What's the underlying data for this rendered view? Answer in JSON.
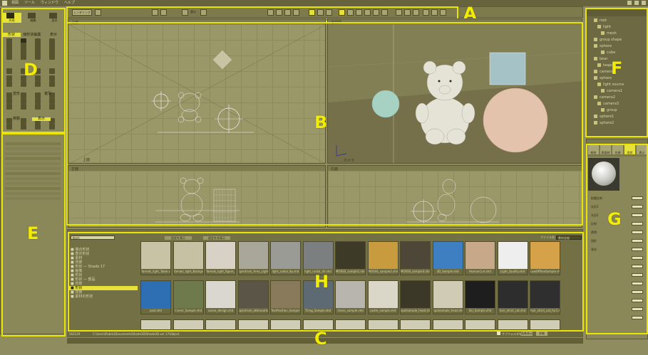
{
  "menu": [
    "",
    "視図",
    "ツール",
    "ウィンドウ",
    "ヘルプ",
    "",
    "",
    "",
    "",
    ""
  ],
  "region_labels": {
    "A": "A",
    "B": "B",
    "C": "C",
    "D": "D",
    "E": "E",
    "F": "F",
    "G": "G",
    "H": "H"
  },
  "toolbar": {
    "render_button_label": "レンダリング",
    "shading_label": "表示"
  },
  "left_tools": {
    "top_tabs": [
      "作成",
      "編集",
      "変形"
    ],
    "section_tabs": [
      "形状",
      "線形状編集",
      "表示"
    ],
    "mid_tabs": [
      "変形",
      "複写",
      "移動"
    ],
    "bottom_tabs": [
      "移動",
      "複写"
    ],
    "bottom_sel": "表示"
  },
  "viewports": [
    {
      "name": "top",
      "label": "上面"
    },
    {
      "name": "perspective",
      "label": "透視図",
      "info": "カメラ"
    },
    {
      "name": "front",
      "label": "正面"
    },
    {
      "name": "right",
      "label": "右面"
    }
  ],
  "browser": {
    "path_value": "Koch",
    "items": [
      "Shade3D",
      "Shade3D",
      "Shade3D",
      "Shade3D"
    ],
    "nav": [
      {
        "label": "■ 複合形状",
        "sel": false
      },
      {
        "label": "■ 表示形状",
        "sel": false
      },
      {
        "label": "■ 素材",
        "sel": false
      },
      {
        "label": "■ 背景",
        "sel": false
      },
      {
        "label": "■ 形状 — Shade 17",
        "sel": false
      },
      {
        "label": "■ 画像",
        "sel": false
      },
      {
        "label": "■ 形状",
        "sel": false
      },
      {
        "label": "■ 形状 — 部品",
        "sel": false
      },
      {
        "label": "■ 背景",
        "sel": false
      },
      {
        "label": "■ 形状",
        "sel": true
      },
      {
        "label": "■ 背景",
        "sel": false
      },
      {
        "label": "■ 素材の形状",
        "sel": false
      }
    ],
    "row1": [
      {
        "caption": "Yamaki_light_Table.shd",
        "bg": "#c9c3a6"
      },
      {
        "caption": "Yamaki_light_Background",
        "bg": "#c7c1a3"
      },
      {
        "caption": "Yamaki_light_figure_fina",
        "bg": "#d8d1c6"
      },
      {
        "caption": "spectrum_Area_Light.shd",
        "bg": "#a9a79a"
      },
      {
        "caption": "light_radial_Sp.shd",
        "bg": "#9a9b95"
      },
      {
        "caption": "light_radial_dir.shd",
        "bg": "#7c7f80"
      },
      {
        "caption": "MOSSS_sample1.shd",
        "bg": "#3d3a28"
      },
      {
        "caption": "MOSSS_sample2.shd",
        "bg": "#c89b3e"
      },
      {
        "caption": "MOSSS_sample3.shd",
        "bg": "#4d4738"
      },
      {
        "caption": "3D_Sample.shd",
        "bg": "#3e7fc1"
      },
      {
        "caption": "HumanCurl.shd",
        "bg": "#c7a888"
      },
      {
        "caption": "Light_Quality.shd",
        "bg": "#eeeeee"
      },
      {
        "caption": "LowOfflineSample.shd",
        "bg": "#d5a24a"
      }
    ],
    "row2": [
      {
        "caption": "pool.shd",
        "bg": "#2e6eb3"
      },
      {
        "caption": "Cinect_Sample.shd",
        "bg": "#6e7a4c"
      },
      {
        "caption": "scene_design.shd",
        "bg": "#d9d7d0"
      },
      {
        "caption": "spectrum_attenuation.shd",
        "bg": "#5b5548"
      },
      {
        "caption": "TextPosition_Sample.shd",
        "bg": "#8a7a5c"
      },
      {
        "caption": "Tiling_Sample.shd",
        "bg": "#5e6a73"
      },
      {
        "caption": "chess_sample.shd",
        "bg": "#b7b5ad"
      },
      {
        "caption": "castle_sample.shd",
        "bg": "#dad7c8"
      },
      {
        "caption": "spotsample_head.shd",
        "bg": "#3b3828"
      },
      {
        "caption": "spotsample_head.shd",
        "bg": "#d0cbb4"
      },
      {
        "caption": "Ski_Sample.shd",
        "bg": "#1e1e1e"
      },
      {
        "caption": "hair_strict_cat.shd",
        "bg": "#2d2d2d"
      },
      {
        "caption": "hair_strict_cat_fur1.shd",
        "bg": "#2f2f2f"
      }
    ]
  },
  "status": {
    "path": "C:\\Users\\Public\\Documents\\Shade3D\\Shade3D ver 17\\Object",
    "count": "562129"
  },
  "browser_tabs": [
    "設定を表示",
    "設定を非表示"
  ],
  "browser_right": {
    "search_label": "ファイル名",
    "search_value": "素材全般"
  },
  "browser_bottom": {
    "check_label": "サブフォルダを検索",
    "btn1": "画像表示",
    "btn2": "詳細"
  },
  "scene_tree": {
    "items": [
      "root",
      "light",
      "mesh",
      "group shape",
      "sphere",
      "cube",
      "bear",
      "teapot",
      "camera",
      "sphere",
      "light source",
      "camera1",
      "camera2",
      "camera3",
      "group",
      "sphere1",
      "sphere2"
    ]
  },
  "right_props": {
    "tabs": [
      "統合",
      "表面材質",
      "光源",
      "形状",
      "表示"
    ],
    "labels": [
      "拡散反射",
      "光沢1",
      "光沢2",
      "反射",
      "透明",
      "屈折",
      "発光",
      "",
      "",
      "",
      "",
      "",
      "",
      "",
      ""
    ],
    "section1": "テクスチャ",
    "section2": "パターン",
    "section3": "マッピング",
    "material_preview_label": "球"
  },
  "bottom_buttons": [
    "",
    "",
    "",
    "",
    "",
    "",
    "",
    "",
    "",
    "",
    ""
  ]
}
